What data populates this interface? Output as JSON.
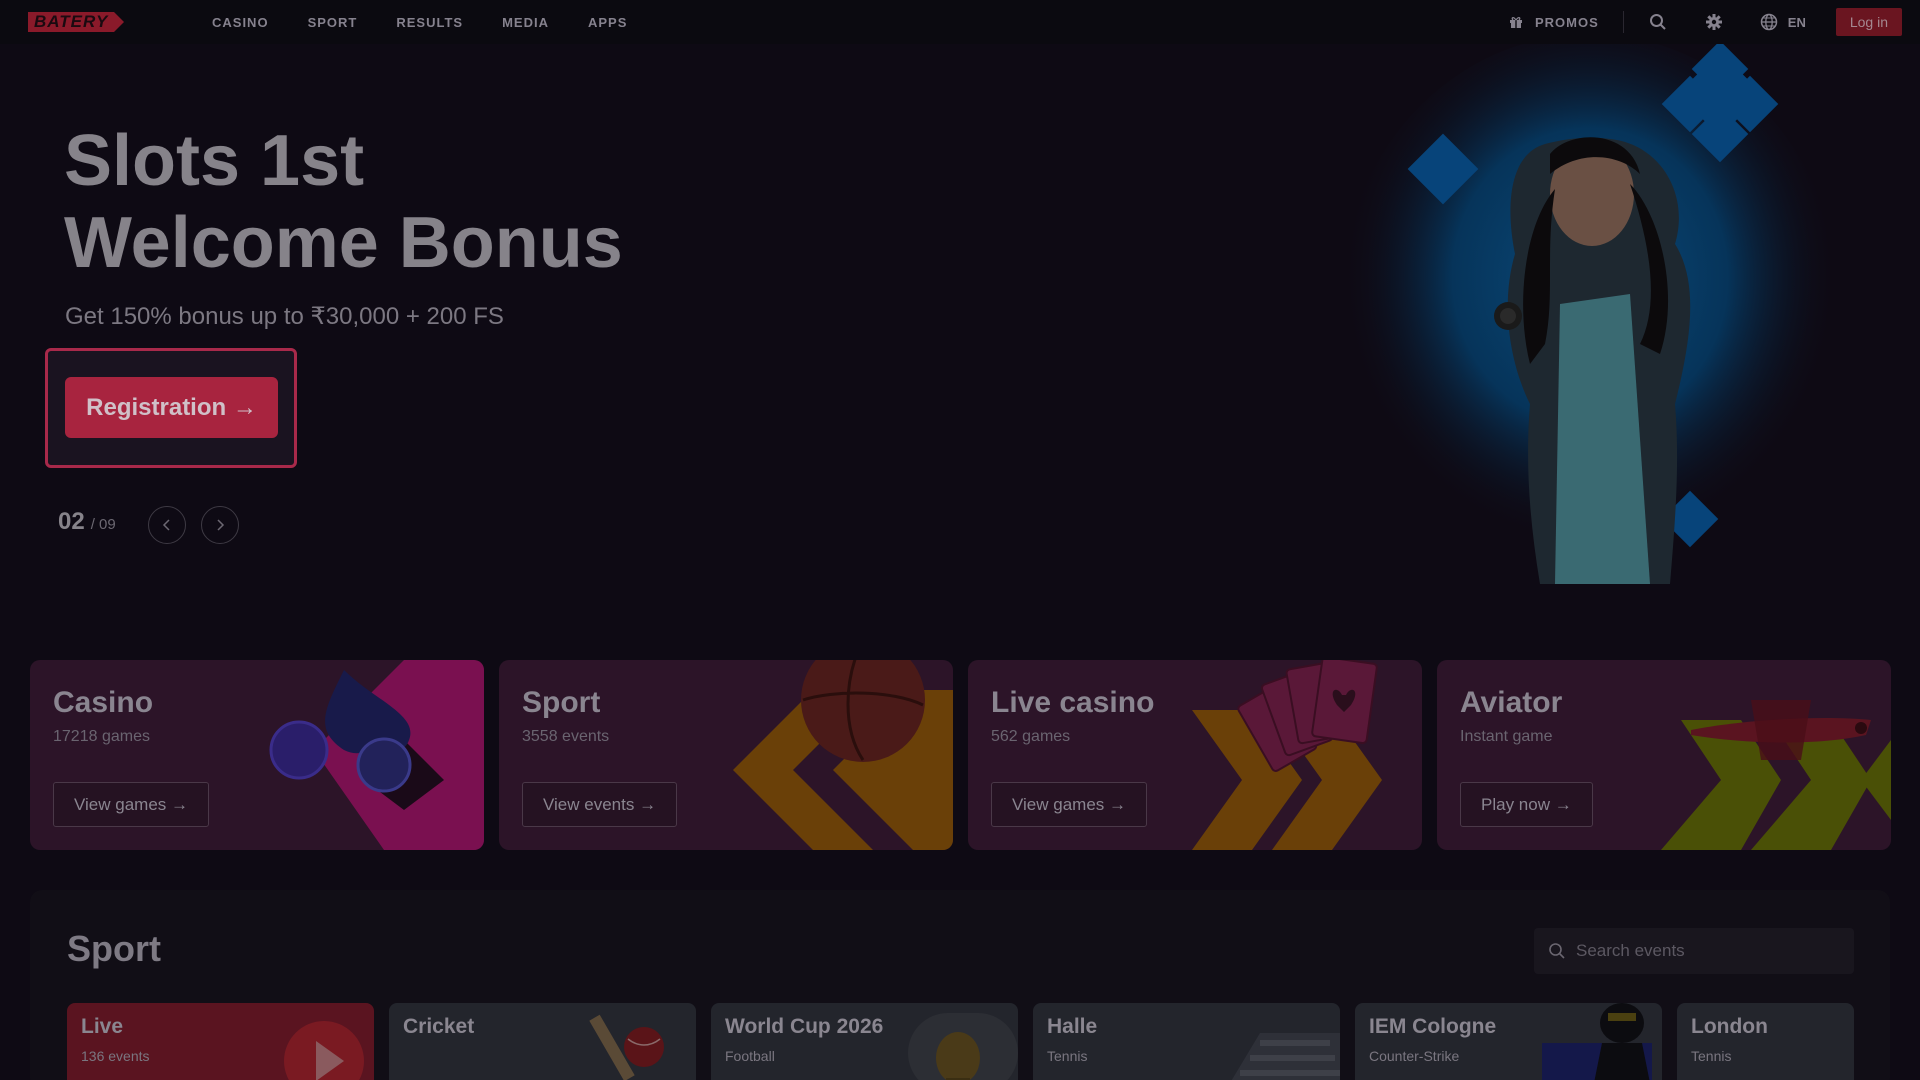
{
  "nav": {
    "logo": "BATERY",
    "links": [
      "CASINO",
      "SPORT",
      "RESULTS",
      "MEDIA",
      "APPS"
    ],
    "promos": "PROMOS",
    "lang": "EN",
    "login": "Log in"
  },
  "hero": {
    "title_line1": "Slots 1st",
    "title_line2": "Welcome Bonus",
    "subtitle": "Get 150% bonus up to ₹30,000 + 200 FS",
    "cta": "Registration →",
    "slide_current": "02",
    "slide_total": "/ 09"
  },
  "categories": [
    {
      "title": "Casino",
      "sub": "17218 games",
      "btn": "View games →"
    },
    {
      "title": "Sport",
      "sub": "3558 events",
      "btn": "View events →"
    },
    {
      "title": "Live casino",
      "sub": "562 games",
      "btn": "View games →"
    },
    {
      "title": "Aviator",
      "sub": "Instant game",
      "btn": "Play now →"
    }
  ],
  "sport": {
    "title": "Sport",
    "search_placeholder": "Search events",
    "cards": [
      {
        "title": "Live",
        "sub": "136 events"
      },
      {
        "title": "Cricket",
        "sub": ""
      },
      {
        "title": "World Cup 2026",
        "sub": "Football"
      },
      {
        "title": "Halle",
        "sub": "Tennis"
      },
      {
        "title": "IEM Cologne",
        "sub": "Counter-Strike"
      },
      {
        "title": "London",
        "sub": "Tennis"
      }
    ]
  },
  "colors": {
    "accent": "#a8243f",
    "background": "#0e0a14",
    "card": "#2c1428"
  }
}
